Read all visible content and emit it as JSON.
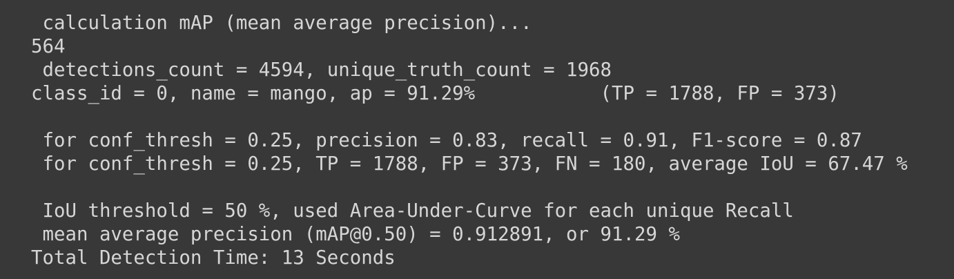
{
  "terminal": {
    "lines": [
      " calculation mAP (mean average precision)...",
      "564",
      " detections_count = 4594, unique_truth_count = 1968",
      "class_id = 0, name = mango, ap = 91.29%           (TP = 1788, FP = 373)",
      "",
      " for conf_thresh = 0.25, precision = 0.83, recall = 0.91, F1-score = 0.87",
      " for conf_thresh = 0.25, TP = 1788, FP = 373, FN = 180, average IoU = 67.47 %",
      "",
      " IoU threshold = 50 %, used Area-Under-Curve for each unique Recall",
      " mean average precision (mAP@0.50) = 0.912891, or 91.29 %",
      "Total Detection Time: 13 Seconds"
    ]
  },
  "colors": {
    "background": "#383838",
    "text": "#d6d6d6"
  }
}
